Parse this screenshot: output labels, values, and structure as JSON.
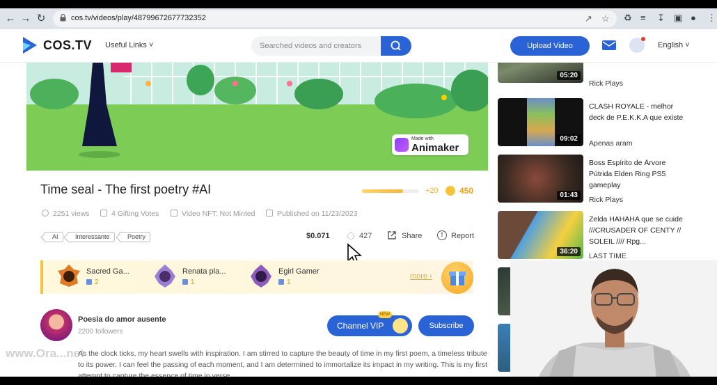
{
  "browser": {
    "url": "cos.tv/videos/play/48799672677732352"
  },
  "header": {
    "logo": "COS.TV",
    "useful_links": "Useful Links ˅",
    "search_placeholder": "Searched videos and creators",
    "upload_label": "Upload Video",
    "language": "English ˅",
    "brand_color": "#2a63d6"
  },
  "banner": {
    "made_with": "Made with",
    "brand": "Animaker"
  },
  "video": {
    "title": "Time seal - The first poetry #AI",
    "reward_progress": 0.72,
    "reward_plus": "+20",
    "coins": "450",
    "views": "2251 views",
    "gifting_votes": "4 Gifting Votes",
    "nft": "Video NFT: Not Minted",
    "published": "Published on 11/23/2023",
    "tags": [
      "AI",
      "Interessante",
      "Poetry"
    ],
    "price": "$0.071",
    "likes": "427",
    "share_label": "Share",
    "report_label": "Report"
  },
  "gifters": {
    "items": [
      {
        "name": "Sacred Ga...",
        "count": "2"
      },
      {
        "name": "Renata pla...",
        "count": "1"
      },
      {
        "name": "Egirl Gamer",
        "count": "1"
      }
    ],
    "more_label": "more ›"
  },
  "channel": {
    "name": "Poesia do amor ausente",
    "followers": "2200 followers",
    "vip_label": "Channel VIP",
    "vip_new": "NEW",
    "subscribe_label": "Subscribe"
  },
  "description": "As the clock ticks, my heart swells with inspiration. I am stirred to capture the beauty of time in my first poem, a timeless tribute to its power. I can feel the passing of each moment, and I am determined to immortalize its impact in my writing. This is my first attempt to capture the essence of time in verse.",
  "watermark": "www.Ora...net",
  "related": [
    {
      "title": "",
      "author": "Rick Plays",
      "duration": "05:20"
    },
    {
      "title": "CLASH ROYALE - melhor deck de P.E.K.K.A que existe",
      "author": "Apenas aram",
      "duration": "09:02"
    },
    {
      "title": "Boss Espírito de Árvore Pútrida Elden Ring PS5 gameplay",
      "author": "Rick Plays",
      "duration": "01:43"
    },
    {
      "title": "Zelda HAHAHA que se cuide ///CRUSADER OF CENTY // SOLEIL //// Rpg...",
      "author": "LAST TIME",
      "duration": "36:20"
    }
  ]
}
